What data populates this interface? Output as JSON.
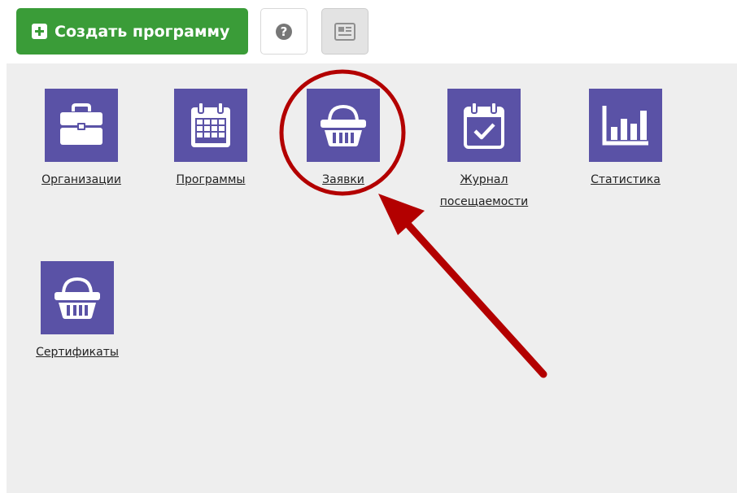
{
  "toolbar": {
    "create_label": "Создать программу",
    "help_glyph": "?"
  },
  "tiles": [
    {
      "label": "Организации",
      "icon": "briefcase-icon"
    },
    {
      "label": "Программы",
      "icon": "calendar-icon"
    },
    {
      "label": "Заявки",
      "icon": "basket-icon"
    },
    {
      "label_line1": "Журнал",
      "label_line2": "посещаемости",
      "icon": "calendar-check-icon"
    },
    {
      "label": "Статистика",
      "icon": "bar-chart-icon"
    },
    {
      "label": "Сертификаты",
      "icon": "basket-icon"
    }
  ],
  "colors": {
    "accent_green": "#3a9c38",
    "tile_purple": "#5a52a6",
    "content_bg": "#eeeeee",
    "annotation_red": "#b30000"
  }
}
